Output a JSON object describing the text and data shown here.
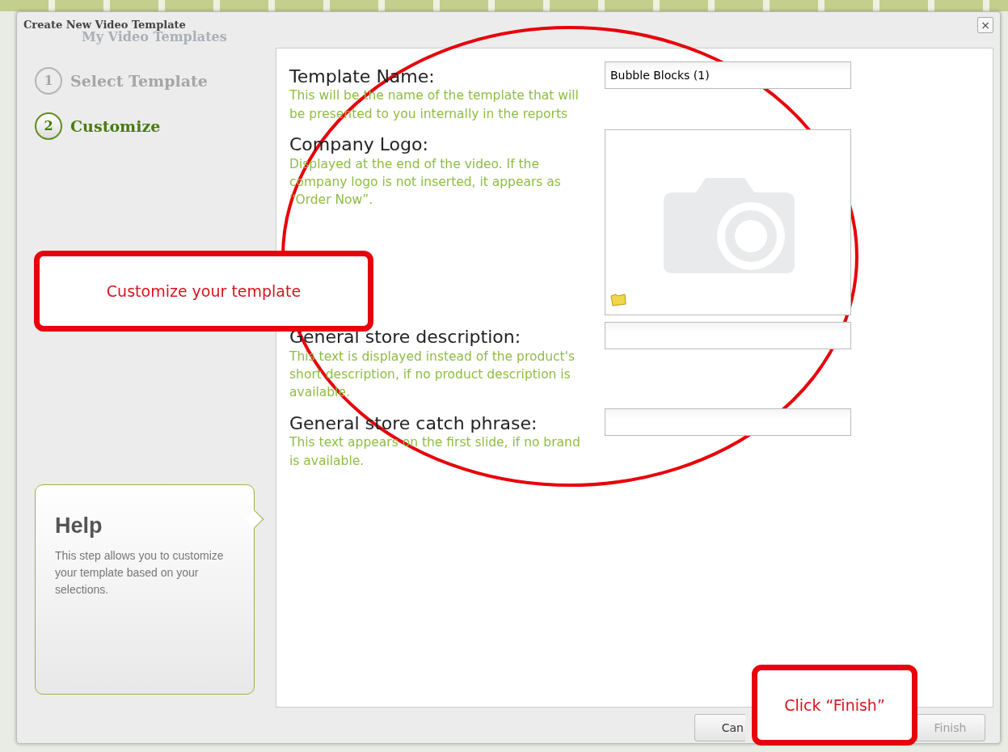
{
  "background": {
    "page_title": "My Video Templates"
  },
  "dialog": {
    "title": "Create New Video Template",
    "close": "×"
  },
  "steps": [
    {
      "number": "1",
      "label": "Select Template",
      "selected": false
    },
    {
      "number": "2",
      "label": "Customize",
      "selected": true
    }
  ],
  "help": {
    "title": "Help",
    "text": "This step allows you to customize your template based on your selections."
  },
  "fields": [
    {
      "kind": "text",
      "label": "Template Name:",
      "hint": "This will be the name of the template that will be presented to you internally in the reports",
      "value": "Bubble Blocks (1)"
    },
    {
      "kind": "image",
      "label": "Company Logo:",
      "hint": "Displayed at the end of the video. If the company logo is not inserted, it appears as “Order Now”."
    },
    {
      "kind": "text",
      "label": "General store description:",
      "hint": "This text is displayed instead of the product's short description, if no product description is available."
    },
    {
      "kind": "text",
      "label": "General store catch phrase:",
      "hint": "This text appears on the first slide, if no brand is available."
    }
  ],
  "buttons": [
    {
      "label": "Can",
      "disabled": false
    },
    {
      "label": "Finish",
      "disabled": true
    }
  ],
  "annotations": [
    {
      "text": "Customize your template"
    },
    {
      "text": "Click “Finish”"
    }
  ]
}
